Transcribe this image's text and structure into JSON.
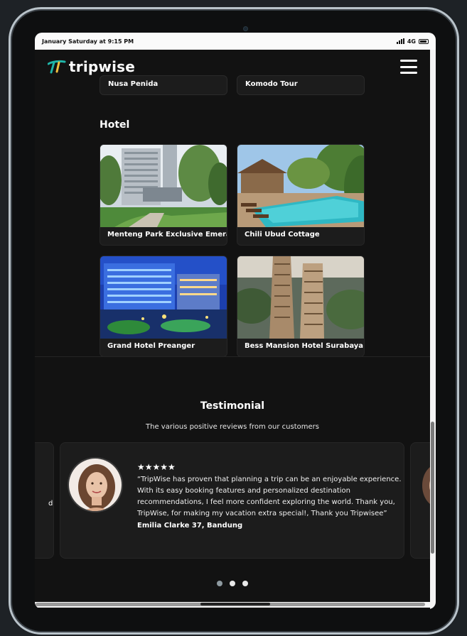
{
  "status_bar": {
    "time": "January Saturday at 9:15 PM",
    "network": "4G"
  },
  "navbar": {
    "logo_text": "tripwise",
    "menu_icon": "hamburger-menu-icon"
  },
  "previous_cards": [
    {
      "name": "Nusa Penida"
    },
    {
      "name": "Komodo Tour"
    }
  ],
  "hotel_section": {
    "title": "Hotel",
    "items": [
      {
        "name": "Menteng Park Exclusive Emerald"
      },
      {
        "name": "Chili Ubud Cottage"
      },
      {
        "name": "Grand Hotel Preanger"
      },
      {
        "name": "Bess Mansion Hotel Surabaya"
      }
    ]
  },
  "testimonial": {
    "title": "Testimonial",
    "subtitle": "The various positive reviews from our customers",
    "rating_stars": 5,
    "stars": "★★★★★",
    "quote": "“TripWise has proven that planning a trip can be an enjoyable experience. With its easy booking features and personalized destination recommendations, I feel more confident exploring the world. Thank you, TripWise, for making my vacation extra special!, Thank you Tripwisee”",
    "author": "Emilia Clarke 37, Bandung",
    "side_fragment": "d",
    "carousel_pages": 3,
    "active_page": 1
  },
  "colors": {
    "page_bg": "#121212",
    "card_bg": "#1c1c1c",
    "accent_teal": "#1fb5a8",
    "text": "#ffffff"
  }
}
